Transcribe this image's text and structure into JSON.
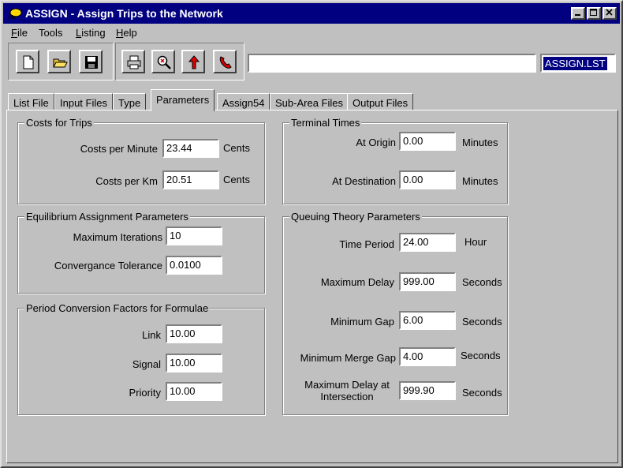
{
  "window": {
    "title": "ASSIGN - Assign Trips to the Network"
  },
  "menu": [
    {
      "label_underline": "F",
      "label_rest": "ile"
    },
    {
      "label_underline": "",
      "label_rest": "Tools"
    },
    {
      "label_underline": "L",
      "label_rest": "isting"
    },
    {
      "label_underline": "H",
      "label_rest": "elp"
    }
  ],
  "toolbar": {
    "buttons": [
      "new-file-icon",
      "open-folder-icon",
      "save-disk-icon",
      "print-icon",
      "zoom-icon",
      "run-arrow-icon",
      "phone-icon"
    ],
    "path_value": "",
    "list_file": "ASSIGN.LST"
  },
  "tabs": [
    "List File",
    "Input Files",
    "Type",
    "Parameters",
    "Assign54",
    "Sub-Area Files",
    "Output Files"
  ],
  "costs": {
    "title": "Costs for Trips",
    "per_minute_label": "Costs per Minute",
    "per_minute_value": "23.44",
    "per_minute_unit": "Cents",
    "per_km_label": "Costs per Km",
    "per_km_value": "20.51",
    "per_km_unit": "Cents"
  },
  "equilibrium": {
    "title": "Equilibrium Assignment Parameters",
    "max_iter_label": "Maximum Iterations",
    "max_iter_value": "10",
    "tolerance_label": "Convergance Tolerance",
    "tolerance_value": "0.0100"
  },
  "period": {
    "title": "Period Conversion Factors for Formulae",
    "link_label": "Link",
    "link_value": "10.00",
    "signal_label": "Signal",
    "signal_value": "10.00",
    "priority_label": "Priority",
    "priority_value": "10.00"
  },
  "terminal": {
    "title": "Terminal Times",
    "origin_label": "At Origin",
    "origin_value": "0.00",
    "origin_unit": "Minutes",
    "dest_label": "At Destination",
    "dest_value": "0.00",
    "dest_unit": "Minutes"
  },
  "queuing": {
    "title": "Queuing Theory Parameters",
    "time_period_label": "Time Period",
    "time_period_value": "24.00",
    "time_period_unit": "Hour",
    "max_delay_label": "Maximum Delay",
    "max_delay_value": "999.00",
    "max_delay_unit": "Seconds",
    "min_gap_label": "Minimum Gap",
    "min_gap_value": "6.00",
    "min_gap_unit": "Seconds",
    "merge_gap_label": "Minimum Merge Gap",
    "merge_gap_value": "4.00",
    "merge_gap_unit": "Seconds",
    "delay_int_label_1": "Maximum Delay at",
    "delay_int_label_2": "Intersection",
    "delay_int_value": "999.90",
    "delay_int_unit": "Seconds"
  }
}
